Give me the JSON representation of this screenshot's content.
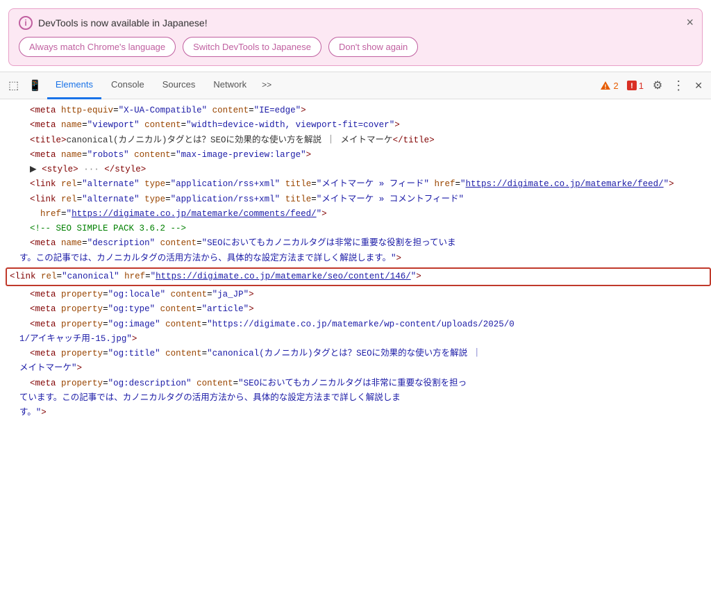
{
  "notification": {
    "title": "DevTools is now available in Japanese!",
    "button1": "Always match Chrome's language",
    "button2": "Switch DevTools to Japanese",
    "button3": "Don't show again",
    "close": "×"
  },
  "toolbar": {
    "tabs": [
      {
        "label": "Elements",
        "active": true
      },
      {
        "label": "Console",
        "active": false
      },
      {
        "label": "Sources",
        "active": false
      },
      {
        "label": "Network",
        "active": false
      },
      {
        "label": ">>",
        "active": false
      }
    ],
    "warning_count": "2",
    "error_count": "1"
  },
  "code": {
    "lines": [
      {
        "indent": false,
        "content": "<meta http-equiv=\"X-UA-Compatible\" content=\"IE=edge\">"
      },
      {
        "indent": false,
        "content": "<meta name=\"viewport\" content=\"width=device-width, viewport-fit=cover\">"
      },
      {
        "indent": false,
        "content": "<title>canonical(カノニカル)タグとは？SEOに効果的な使い方を解説 ｜ メイトマーケ</title>"
      },
      {
        "indent": false,
        "content": "<meta name=\"robots\" content=\"max-image-preview:large\">"
      },
      {
        "indent": false,
        "content": "▶ <style> ··· </style>"
      },
      {
        "indent": false,
        "content": "<link rel=\"alternate\" type=\"application/rss+xml\" title=\"メイトマーケ » フィード\" href=\"https://digimate.co.jp/matemarke/feed/\">"
      },
      {
        "indent": false,
        "content": "<link rel=\"alternate\" type=\"application/rss+xml\" title=\"メイトマーケ » コメントフィード\" href=\"https://digimate.co.jp/matemarke/comments/feed/\">"
      },
      {
        "indent": false,
        "content": "<!-- SEO SIMPLE PACK 3.6.2 -->"
      },
      {
        "indent": false,
        "content": "<meta name=\"description\" content=\"SEOにおいてもカノニカルタグは非常に重要な役割を担っています。この記事では、カノニカルタグの活用方法から、具体的な設定方法まで詳しく解説します。\">"
      },
      {
        "indent": false,
        "content": "<link rel=\"canonical\" href=\"https://digimate.co.jp/matemarke/seo/content/146/\">",
        "highlighted": true
      },
      {
        "indent": false,
        "content": "<meta property=\"og:locale\" content=\"ja_JP\">"
      },
      {
        "indent": false,
        "content": "<meta property=\"og:type\" content=\"article\">"
      },
      {
        "indent": false,
        "content": "<meta property=\"og:image\" content=\"https://digimate.co.jp/matemarke/wp-content/uploads/2025/01/アイキャッチ用-15.jpg\">"
      },
      {
        "indent": false,
        "content": "<meta property=\"og:title\" content=\"canonical(カノニカル)タグとは？SEOに効果的な使い方を解説 ｜ メイトマーケ\">"
      },
      {
        "indent": false,
        "content": "<meta property=\"og:description\" content=\"SEOにおいてもカノニカルタグは非常に重要な役割を担っています。この記事では、カノニカルタグの活用方法から、具体的な設定方法まで詳しく解説します。\">"
      }
    ]
  }
}
